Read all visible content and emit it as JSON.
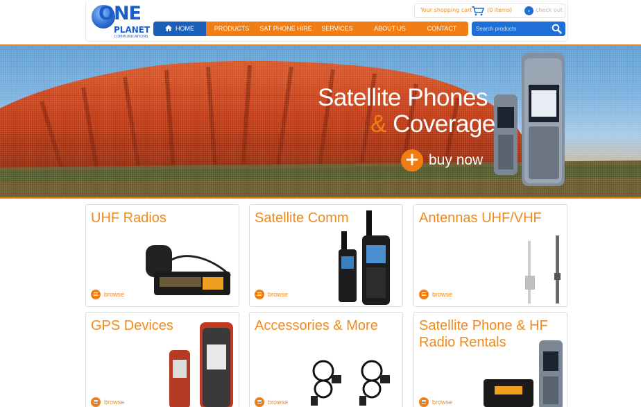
{
  "header": {
    "logo": {
      "line1": "ONE",
      "line2": "PLANET",
      "line3": "COMMUNICATIONS"
    },
    "cart": {
      "label": "Your shopping cart",
      "count": "(0 items)",
      "checkout": "check out"
    },
    "nav": [
      {
        "label": "HOME"
      },
      {
        "label": "PRODUCTS"
      },
      {
        "label": "SAT PHONE HIRE"
      },
      {
        "label": "SERVICES"
      },
      {
        "label": "ABOUT US"
      },
      {
        "label": "CONTACT"
      }
    ],
    "search": {
      "placeholder": "Search products"
    }
  },
  "banner": {
    "title_line1": "Satellite Phones",
    "title_amp": "&",
    "title_line2": "Coverage",
    "buy_label": "buy now"
  },
  "cards": [
    {
      "title": "UHF Radios",
      "browse": "browse",
      "icon": "uhf-radio-image"
    },
    {
      "title": "Satellite Comm",
      "browse": "browse",
      "icon": "satellite-phones-image"
    },
    {
      "title": "Antennas UHF/VHF",
      "browse": "browse",
      "icon": "antenna-image"
    },
    {
      "title": "GPS Devices",
      "browse": "browse",
      "icon": "gps-devices-image"
    },
    {
      "title": "Accessories & More",
      "browse": "browse",
      "icon": "accessories-image"
    },
    {
      "title": "Satellite Phone & HF Radio Rentals",
      "browse": "browse",
      "icon": "rentals-image"
    }
  ],
  "colors": {
    "accent": "#f07e15",
    "brand_blue": "#1c5fb8",
    "text_orange": "#f08a1c"
  }
}
